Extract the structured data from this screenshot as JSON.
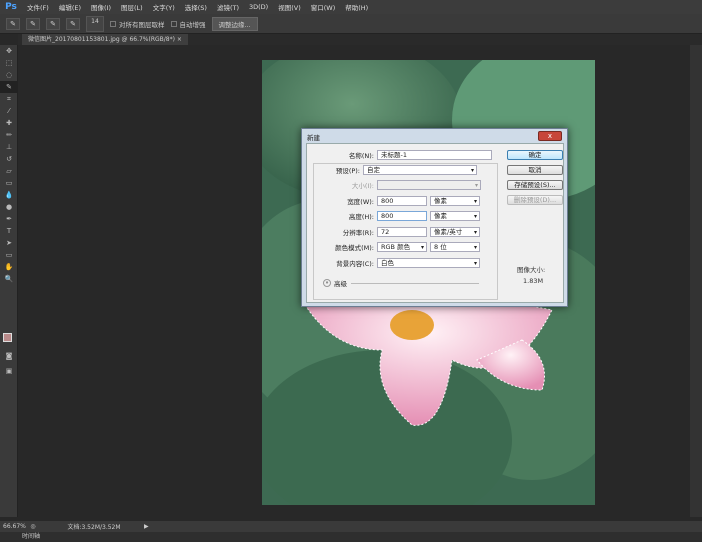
{
  "app": {
    "logo": "Ps"
  },
  "menu": [
    "文件(F)",
    "编辑(E)",
    "图像(I)",
    "图层(L)",
    "文字(Y)",
    "选择(S)",
    "滤镜(T)",
    "3D(D)",
    "视图(V)",
    "窗口(W)",
    "帮助(H)"
  ],
  "options": {
    "brush_size": "14",
    "sample_all_layers": "对所有图层取样",
    "auto_enhance": "自动增强",
    "refine_edge": "调整边缘..."
  },
  "document_tab": {
    "title": "微信图片_20170801153801.jpg @ 66.7%(RGB/8*)",
    "close": "×"
  },
  "status": {
    "zoom": "66.67%",
    "doc_info": "文档:3.52M/3.52M",
    "arrow": "▶"
  },
  "timeline": {
    "label": "时间轴"
  },
  "dialog": {
    "title": "新建",
    "close": "x",
    "name_label": "名称(N):",
    "name_value": "未标题-1",
    "preset_label": "预设(P):",
    "preset_value": "自定",
    "size_label": "大小(I):",
    "size_value": "",
    "width_label": "宽度(W):",
    "width_value": "800",
    "width_unit": "像素",
    "height_label": "高度(H):",
    "height_value": "800",
    "height_unit": "像素",
    "resolution_label": "分辨率(R):",
    "resolution_value": "72",
    "resolution_unit": "像素/英寸",
    "color_mode_label": "颜色模式(M):",
    "color_mode_value": "RGB 颜色",
    "bit_depth": "8 位",
    "background_label": "背景内容(C):",
    "background_value": "白色",
    "advanced_label": "高级",
    "advanced_icon": "»",
    "ok": "确定",
    "cancel": "取消",
    "save_preset": "存储预设(S)...",
    "delete_preset": "删除预设(D)...",
    "image_size_label": "图像大小:",
    "image_size_value": "1.83M"
  },
  "colors": {
    "foreground": "#b98a8a",
    "background": "#ffffff"
  }
}
